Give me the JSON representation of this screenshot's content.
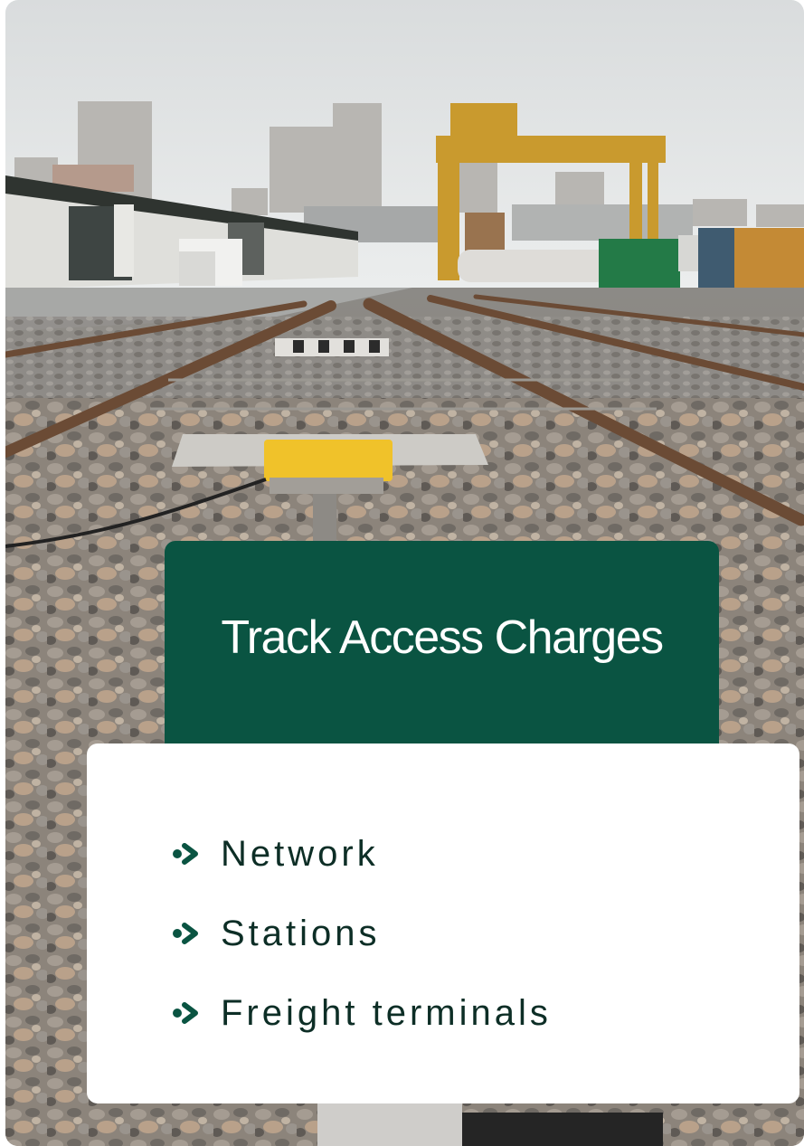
{
  "title": "Track Access Charges",
  "items": [
    {
      "label": "Network",
      "icon": "double-chevron-right-icon"
    },
    {
      "label": "Stations",
      "icon": "double-chevron-right-icon"
    },
    {
      "label": "Freight terminals",
      "icon": "double-chevron-right-icon"
    }
  ],
  "colors": {
    "accent_green": "#0a5442",
    "text_dark": "#0d2e26",
    "panel_white": "#ffffff"
  }
}
